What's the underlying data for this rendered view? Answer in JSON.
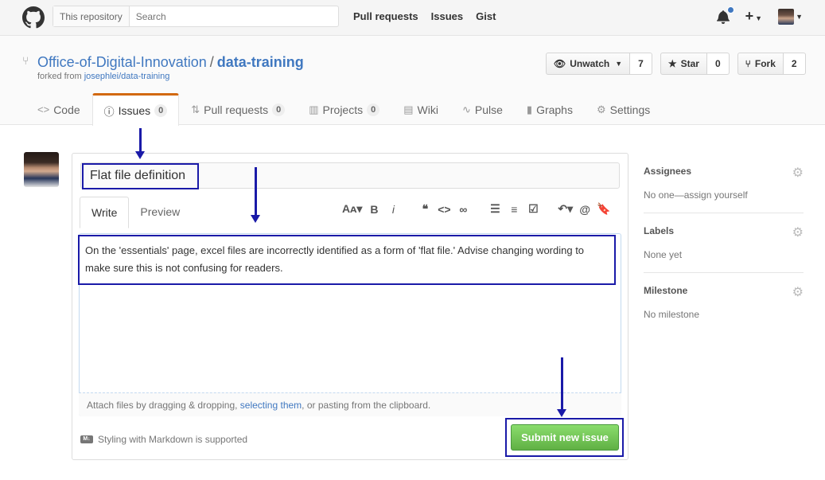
{
  "header": {
    "search_scope": "This repository",
    "search_placeholder": "Search",
    "nav": [
      "Pull requests",
      "Issues",
      "Gist"
    ]
  },
  "repo": {
    "owner": "Office-of-Digital-Innovation",
    "separator": "/",
    "name": "data-training",
    "forked_prefix": "forked from ",
    "forked_link": "josephlei/data-training",
    "watch": {
      "label": "Unwatch",
      "count": "7"
    },
    "star": {
      "label": "Star",
      "count": "0"
    },
    "fork": {
      "label": "Fork",
      "count": "2"
    },
    "tabs": [
      {
        "label": "Code"
      },
      {
        "label": "Issues",
        "count": "0"
      },
      {
        "label": "Pull requests",
        "count": "0"
      },
      {
        "label": "Projects",
        "count": "0"
      },
      {
        "label": "Wiki"
      },
      {
        "label": "Pulse"
      },
      {
        "label": "Graphs"
      },
      {
        "label": "Settings"
      }
    ]
  },
  "issue": {
    "title": "Flat file definition",
    "write_tab": "Write",
    "preview_tab": "Preview",
    "body": "On the 'essentials' page, excel files are incorrectly identified as a form of 'flat file.' Advise changing wording to make sure this is not confusing for readers.",
    "attach_prefix": "Attach files by dragging & dropping, ",
    "attach_link": "selecting them",
    "attach_suffix": ", or pasting from the clipboard.",
    "markdown_note": "Styling with Markdown is supported",
    "submit": "Submit new issue"
  },
  "sidebar": {
    "assignees": {
      "label": "Assignees",
      "value": "No one—assign yourself"
    },
    "labels": {
      "label": "Labels",
      "value": "None yet"
    },
    "milestone": {
      "label": "Milestone",
      "value": "No milestone"
    }
  },
  "colors": {
    "accent": "#4078c0",
    "submit": "#60b044",
    "tab_highlight": "#d26911",
    "annotation": "#1a1aa8"
  }
}
